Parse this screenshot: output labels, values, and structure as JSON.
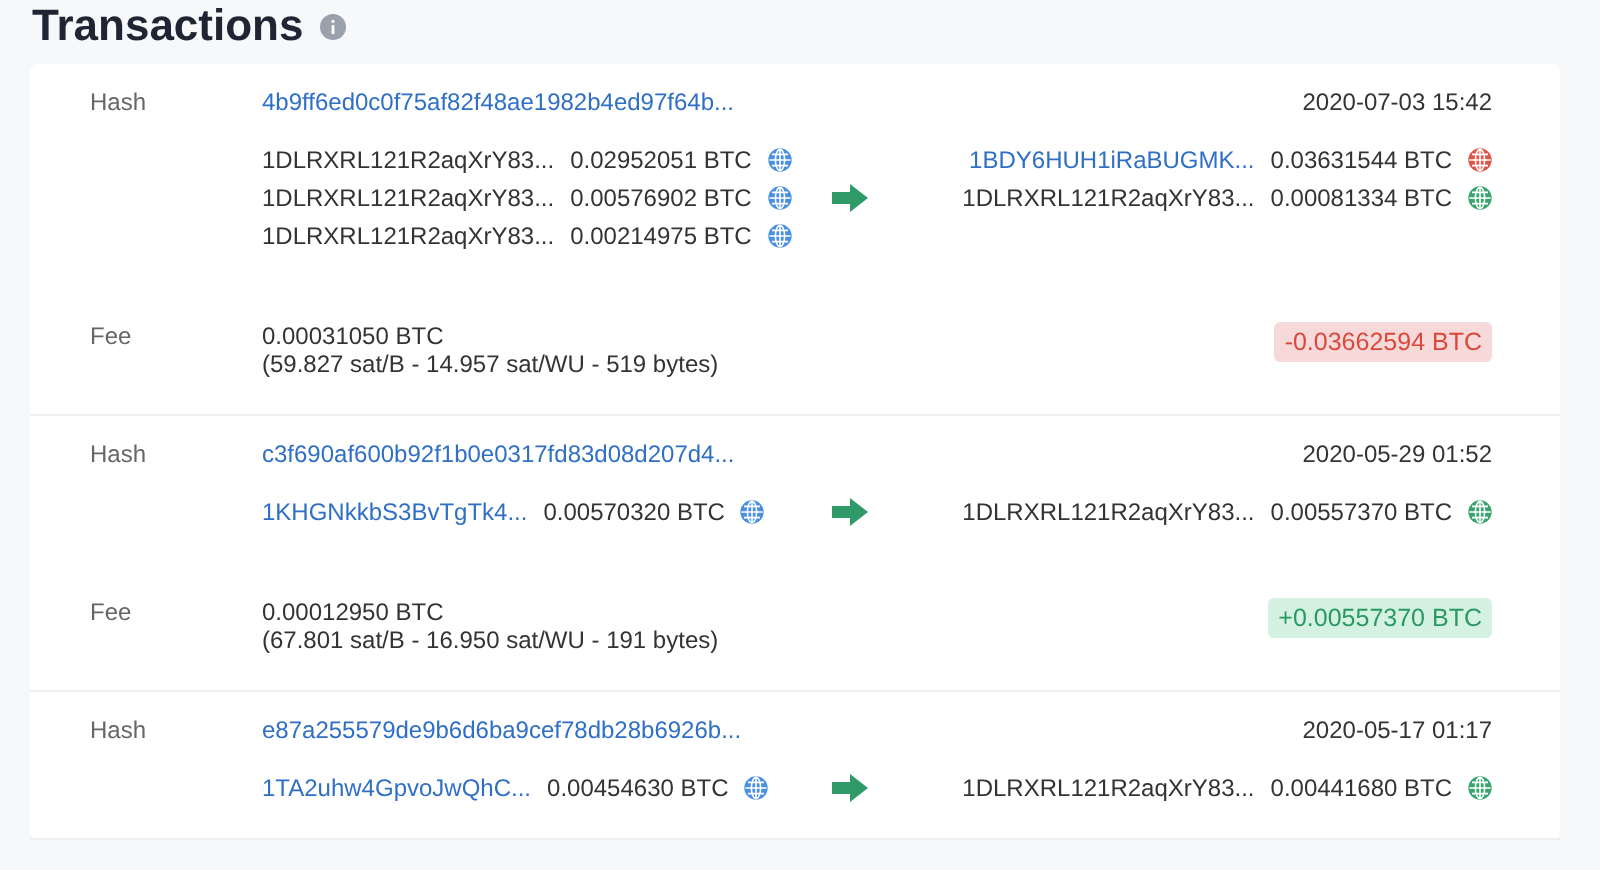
{
  "title": "Transactions",
  "transactions": [
    {
      "hash_label": "Hash",
      "hash": "4b9ff6ed0c0f75af82f48ae1982b4ed97f64b...",
      "date": "2020-07-03 15:42",
      "inputs": [
        {
          "address": "1DLRXRL121R2aqXrY83...",
          "link": false,
          "amount": "0.02952051 BTC",
          "color": "#4a90e2"
        },
        {
          "address": "1DLRXRL121R2aqXrY83...",
          "link": false,
          "amount": "0.00576902 BTC",
          "color": "#4a90e2"
        },
        {
          "address": "1DLRXRL121R2aqXrY83...",
          "link": false,
          "amount": "0.00214975 BTC",
          "color": "#4a90e2"
        }
      ],
      "outputs": [
        {
          "address": "1BDY6HUH1iRaBUGMK...",
          "link": true,
          "amount": "0.03631544 BTC",
          "color": "#e0554a"
        },
        {
          "address": "1DLRXRL121R2aqXrY83...",
          "link": false,
          "amount": "0.00081334 BTC",
          "color": "#3aa56f"
        }
      ],
      "fee_label": "Fee",
      "fee": "0.00031050 BTC",
      "fee_detail": "(59.827 sat/B - 14.957 sat/WU - 519 bytes)",
      "total": "-0.03662594 BTC",
      "kind": "sent"
    },
    {
      "hash_label": "Hash",
      "hash": "c3f690af600b92f1b0e0317fd83d08d207d4...",
      "date": "2020-05-29 01:52",
      "inputs": [
        {
          "address": "1KHGNkkbS3BvTgTk4...",
          "link": true,
          "amount": "0.00570320 BTC",
          "color": "#4a90e2"
        }
      ],
      "outputs": [
        {
          "address": "1DLRXRL121R2aqXrY83...",
          "link": false,
          "amount": "0.00557370 BTC",
          "color": "#3aa56f"
        }
      ],
      "fee_label": "Fee",
      "fee": "0.00012950 BTC",
      "fee_detail": "(67.801 sat/B - 16.950 sat/WU - 191 bytes)",
      "total": "+0.00557370 BTC",
      "kind": "received"
    },
    {
      "hash_label": "Hash",
      "hash": "e87a255579de9b6d6ba9cef78db28b6926b...",
      "date": "2020-05-17 01:17",
      "inputs": [
        {
          "address": "1TA2uhw4GpvoJwQhC...",
          "link": true,
          "amount": "0.00454630 BTC",
          "color": "#4a90e2"
        }
      ],
      "outputs": [
        {
          "address": "1DLRXRL121R2aqXrY83...",
          "link": false,
          "amount": "0.00441680 BTC",
          "color": "#3aa56f"
        }
      ]
    }
  ]
}
